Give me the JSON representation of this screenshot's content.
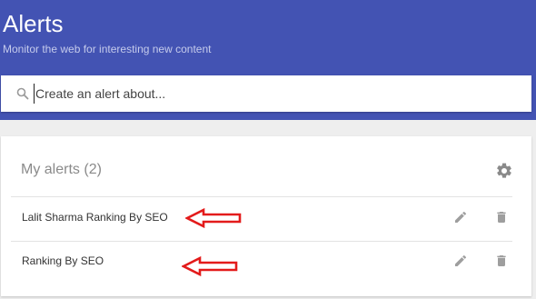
{
  "header": {
    "title": "Alerts",
    "subtitle": "Monitor the web for interesting new content"
  },
  "search": {
    "placeholder": "Create an alert about...",
    "icon": "search-icon"
  },
  "alerts_panel": {
    "title": "My alerts",
    "count": "(2)",
    "settings_icon": "gear-icon",
    "items": [
      {
        "label": "Lalit Sharma Ranking By SEO",
        "edit_icon": "pencil-icon",
        "delete_icon": "trash-icon"
      },
      {
        "label": "Ranking By SEO",
        "edit_icon": "pencil-icon",
        "delete_icon": "trash-icon"
      }
    ]
  },
  "annotations": {
    "arrow_color": "#e31b1b",
    "arrow_icon": "left-arrow-icon"
  },
  "colors": {
    "header_bg": "#4353b3",
    "page_bg": "#eeeeee",
    "card_bg": "#ffffff"
  }
}
